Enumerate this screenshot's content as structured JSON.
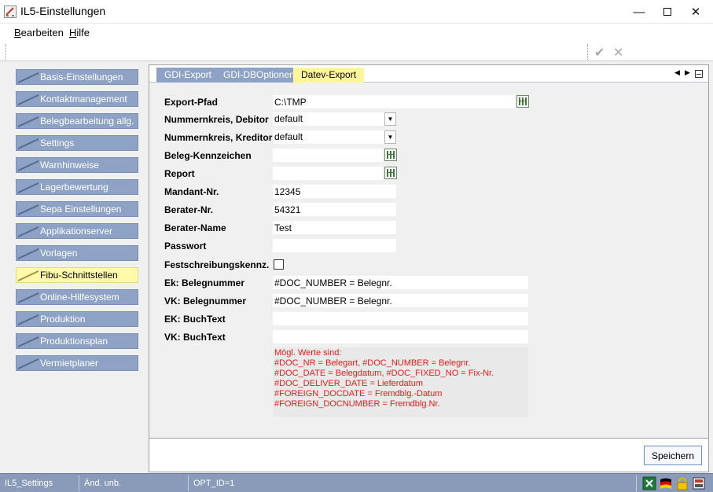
{
  "window": {
    "title": "IL5-Einstellungen"
  },
  "menu": [
    {
      "accel": "B",
      "rest": "earbeiten"
    },
    {
      "accel": "H",
      "rest": "ilfe"
    }
  ],
  "toolbar": {
    "confirm_icon": "check-icon",
    "cancel_icon": "x-icon"
  },
  "sidebar": {
    "items": [
      {
        "label": "Basis-Einstellungen",
        "active": false
      },
      {
        "label": "Kontaktmanagement",
        "active": false
      },
      {
        "label": "Belegbearbeitung allg.",
        "active": false
      },
      {
        "label": "Settings",
        "active": false
      },
      {
        "label": "Warnhinweise",
        "active": false
      },
      {
        "label": "Lagerbewertung",
        "active": false
      },
      {
        "label": "Sepa Einstellungen",
        "active": false
      },
      {
        "label": "Applikationserver",
        "active": false
      },
      {
        "label": "Vorlagen",
        "active": false
      },
      {
        "label": "Fibu-Schnittstellen",
        "active": true
      },
      {
        "label": "Online-Hilfesystem",
        "active": false
      },
      {
        "label": "Produktion",
        "active": false
      },
      {
        "label": "Produktionsplan",
        "active": false
      },
      {
        "label": "Vermietplaner",
        "active": false
      }
    ]
  },
  "tabs": [
    {
      "label": "GDI-Export",
      "active": false
    },
    {
      "label": "GDI-DBOptionen",
      "active": false
    },
    {
      "label": "Datev-Export",
      "active": true
    }
  ],
  "form": {
    "export_pfad": {
      "label": "Export-Pfad",
      "value": "C:\\TMP"
    },
    "nk_debitor": {
      "label": "Nummernkreis, Debitor",
      "value": "default"
    },
    "nk_kreditor": {
      "label": "Nummernkreis, Kreditor",
      "value": "default"
    },
    "beleg_kennzeichen": {
      "label": "Beleg-Kennzeichen",
      "value": ""
    },
    "report": {
      "label": "Report",
      "value": ""
    },
    "mandant_nr": {
      "label": "Mandant-Nr.",
      "value": "12345"
    },
    "berater_nr": {
      "label": "Berater-Nr.",
      "value": "54321"
    },
    "berater_name": {
      "label": "Berater-Name",
      "value": "Test"
    },
    "passwort": {
      "label": "Passwort",
      "value": ""
    },
    "festschreibung": {
      "label": "Festschreibungskennz.",
      "checked": false
    },
    "ek_belegnummer": {
      "label": "Ek: Belegnummer",
      "value": "#DOC_NUMBER = Belegnr."
    },
    "vk_belegnummer": {
      "label": "VK: Belegnummer",
      "value": "#DOC_NUMBER = Belegnr."
    },
    "ek_buchtext": {
      "label": "EK: BuchText",
      "value": ""
    },
    "vk_buchtext": {
      "label": "VK: BuchText",
      "value": ""
    }
  },
  "hint": {
    "lines": [
      "Mögl. Werte sind:",
      "#DOC_NR = Belegart, #DOC_NUMBER = Belegnr.",
      "#DOC_DATE = Belegdatum, #DOC_FIXED_NO = Fix-Nr.",
      "#DOC_DELIVER_DATE = Lieferdatum",
      "#FOREIGN_DOCDATE = Fremdblg.-Datum",
      "#FOREIGN_DOCNUMBER = Fremdblg.Nr."
    ],
    "color": "#e0201c"
  },
  "buttons": {
    "save": "Speichern"
  },
  "status": {
    "cells": [
      "IL5_Settings",
      "Änd. unb.",
      "OPT_ID=1"
    ],
    "icons": [
      "excel-icon",
      "german-flag-icon",
      "lock-icon",
      "print-icon"
    ]
  },
  "colors": {
    "sidebar_button": "#8da2c5",
    "active_item": "#fffaa8",
    "statusbar": "#8a9bba"
  }
}
